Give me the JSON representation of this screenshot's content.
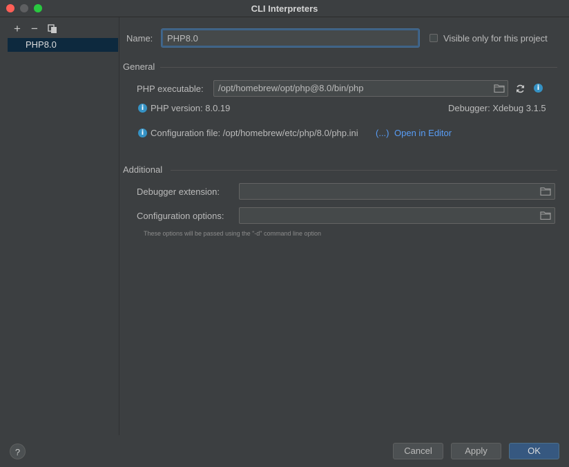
{
  "window": {
    "title": "CLI Interpreters"
  },
  "toolbar": {
    "add": "+",
    "remove": "−"
  },
  "interpreters": [
    {
      "label": "PHP8.0"
    }
  ],
  "form": {
    "name_label": "Name:",
    "name_value": "PHP8.0",
    "visible_only_label": "Visible only for this project",
    "visible_only_checked": false
  },
  "general": {
    "section_title": "General",
    "php_executable_label": "PHP executable:",
    "php_executable_value": "/opt/homebrew/opt/php@8.0/bin/php",
    "php_version_text": "PHP version: 8.0.19",
    "debugger_text": "Debugger:  Xdebug 3.1.5",
    "config_file_text": "Configuration file: /opt/homebrew/etc/php/8.0/php.ini",
    "config_more": "(...)",
    "open_in_editor": "Open in Editor"
  },
  "additional": {
    "section_title": "Additional",
    "debugger_extension_label": "Debugger extension:",
    "debugger_extension_value": "",
    "config_options_label": "Configuration options:",
    "config_options_value": "",
    "hint": "These options will be passed using the \"-d\" command line option"
  },
  "footer": {
    "help": "?",
    "cancel": "Cancel",
    "apply": "Apply",
    "ok": "OK"
  },
  "colors": {
    "accent": "#589df6",
    "selection": "#0d293e",
    "info": "#3592c4",
    "primary_button": "#365880"
  }
}
